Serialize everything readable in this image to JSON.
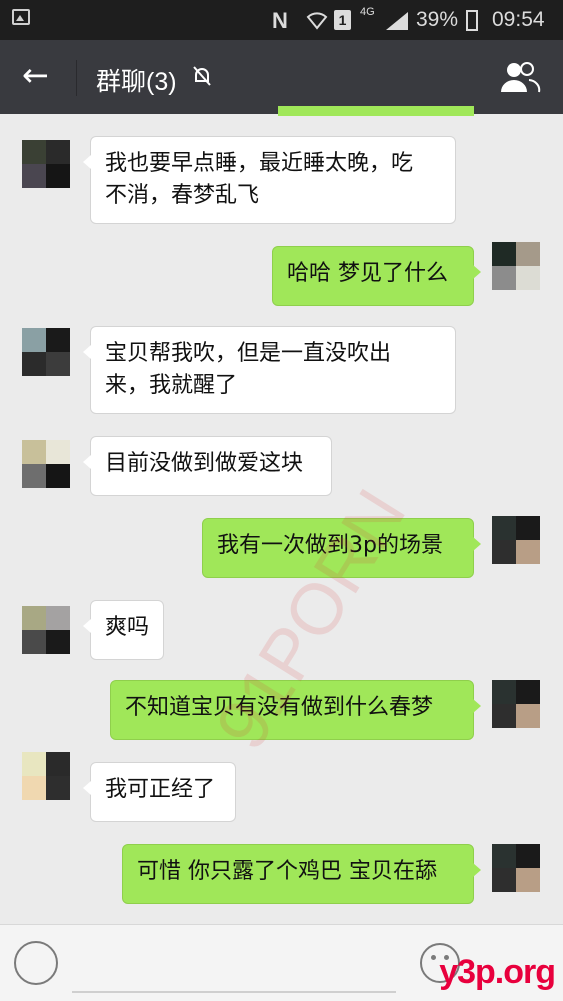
{
  "statusbar": {
    "network_type": "4G",
    "sim_slot": "1",
    "battery": "39%",
    "time": "09:54"
  },
  "header": {
    "title": "群聊(3)",
    "back_icon": "arrow-left-icon",
    "mute_icon": "bell-off-icon",
    "group_icon": "group-members-icon"
  },
  "messages": [
    {
      "side": "in",
      "text_line1": "我也要早点睡，最近睡太晚，吃",
      "text_line2": "不消，春梦乱飞"
    },
    {
      "side": "out",
      "text": "哈哈 梦见了什么"
    },
    {
      "side": "in",
      "text_line1": "宝贝帮我吹，但是一直没吹出",
      "text_line2": "来，我就醒了"
    },
    {
      "side": "in",
      "text": "目前没做到做爱这块"
    },
    {
      "side": "out",
      "text": "我有一次做到3p的场景"
    },
    {
      "side": "in",
      "text": "爽吗"
    },
    {
      "side": "out",
      "text": "不知道宝贝有没有做到什么春梦"
    },
    {
      "side": "in",
      "text": "我可正经了"
    },
    {
      "side": "out",
      "text": "可惜 你只露了个鸡巴 宝贝在舔"
    }
  ],
  "colors": {
    "outgoing_bubble": "#a0e759",
    "incoming_bubble": "#ffffff",
    "chat_background": "#ebebeb",
    "titlebar": "#393a3f"
  },
  "watermarks": {
    "corner": "y3p.org",
    "diagonal": "91PORN"
  }
}
